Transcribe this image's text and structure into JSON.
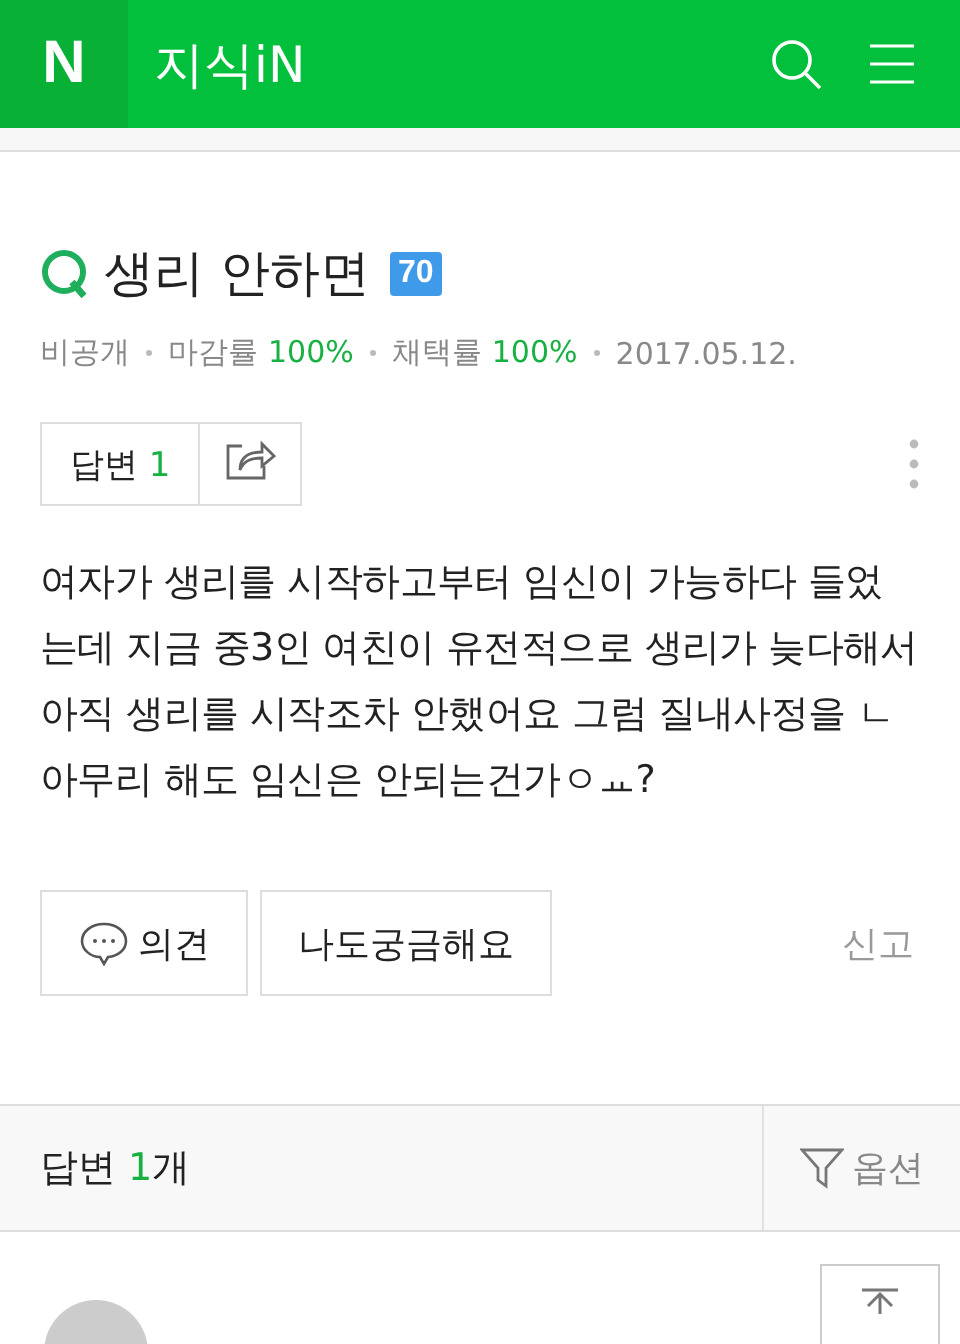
{
  "header": {
    "logo": "N",
    "title": "지식iN"
  },
  "question": {
    "title": "생리 안하면",
    "badge": "70",
    "meta": [
      {
        "label": "비공개"
      },
      {
        "label": "마감률",
        "value": "100%"
      },
      {
        "label": "채택률",
        "value": "100%"
      },
      {
        "label": "2017.05.12."
      }
    ],
    "answer_button": {
      "label": "답변",
      "count": "1"
    },
    "body": "여자가 생리를 시작하고부터 임신이 가능하다 들었는데 지금 중3인 여친이 유전적으로 생리가 늦다해서 아직 생리를 시작조차 안했어요 그럼 질내사정을 ㄴ아무리 해도 임신은 안되는건가ㅇㅛ?",
    "actions": [
      {
        "kind": "comment",
        "label": "의견"
      },
      {
        "kind": "plain",
        "label": "나도궁금해요"
      }
    ],
    "report": "신고"
  },
  "answers_bar": {
    "label": "답변",
    "count": "1",
    "unit": "개",
    "option": "옵션"
  }
}
